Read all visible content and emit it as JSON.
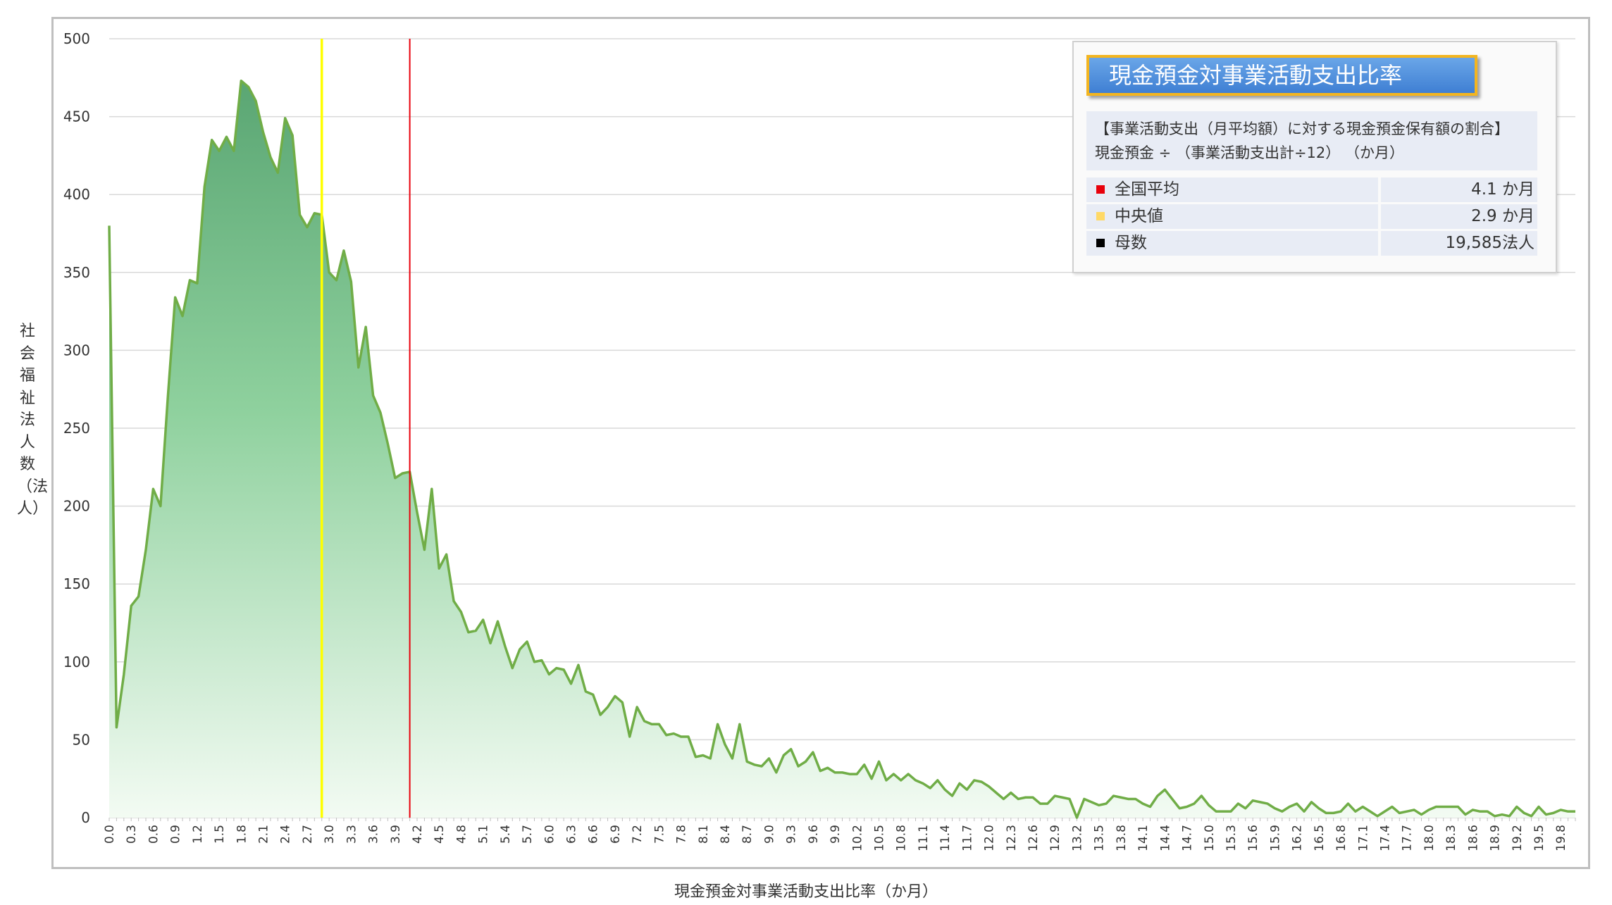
{
  "legend": {
    "title": "現金預金対事業活動支出比率",
    "desc_line1": "【事業活動支出（月平均額）に対する現金預金保有額の割合】",
    "desc_line2": "現金預金 ÷ （事業活動支出計÷12） （か月）",
    "rows": [
      {
        "label": "全国平均",
        "value": "4.1 か月",
        "color": "#e8000b"
      },
      {
        "label": "中央値",
        "value": "2.9 か月",
        "color": "#ffd966"
      },
      {
        "label": "母数",
        "value": "19,585法人",
        "color": "#000000"
      }
    ]
  },
  "colors": {
    "line": "#70ad47",
    "fill_top": "#5aa673",
    "fill_mid": "#8fd19e",
    "fill_bottom": "#f3fbf3",
    "mean_line": "#e8000b",
    "median_line": "#ffff00",
    "grid": "#d9d9d9"
  },
  "chart_data": {
    "type": "area",
    "title": "",
    "xlabel": "現金預金対事業活動支出比率（か月）",
    "ylabel": "社会福祉法人数（法人）",
    "ylim": [
      0,
      500
    ],
    "yticks": [
      0,
      50,
      100,
      150,
      200,
      250,
      300,
      350,
      400,
      450,
      500
    ],
    "x_start": 0.0,
    "x_step": 0.1,
    "x_tick_labels": [
      "0.0",
      "0.3",
      "0.6",
      "0.9",
      "1.2",
      "1.5",
      "1.8",
      "2.1",
      "2.4",
      "2.7",
      "3.0",
      "3.3",
      "3.6",
      "3.9",
      "4.2",
      "4.5",
      "4.8",
      "5.1",
      "5.4",
      "5.7",
      "6.0",
      "6.3",
      "6.6",
      "6.9",
      "7.2",
      "7.5",
      "7.8",
      "8.1",
      "8.4",
      "8.7",
      "9.0",
      "9.3",
      "9.6",
      "9.9",
      "10.2",
      "10.5",
      "10.8",
      "11.1",
      "11.4",
      "11.7",
      "12.0",
      "12.3",
      "12.6",
      "12.9",
      "13.2",
      "13.5",
      "13.8",
      "14.1",
      "14.4",
      "14.7",
      "15.0",
      "15.3",
      "15.6",
      "15.9",
      "16.2",
      "16.5",
      "16.8",
      "17.1",
      "17.4",
      "17.7",
      "18.0",
      "18.3",
      "18.6",
      "18.9",
      "19.2",
      "19.5",
      "19.8"
    ],
    "mean_x": 4.1,
    "median_x": 2.9,
    "grid": true,
    "series": [
      {
        "values": [
          380,
          58,
          92,
          136,
          142,
          172,
          211,
          200,
          270,
          334,
          322,
          345,
          343,
          405,
          435,
          428,
          437,
          428,
          473,
          469,
          460,
          440,
          424,
          414,
          449,
          438,
          387,
          379,
          388,
          387,
          350,
          345,
          364,
          344,
          289,
          315,
          271,
          260,
          240,
          218,
          221,
          222,
          196,
          172,
          211,
          160,
          169,
          139,
          132,
          119,
          120,
          127,
          112,
          126,
          110,
          96,
          108,
          113,
          100,
          101,
          92,
          96,
          95,
          86,
          98,
          81,
          79,
          66,
          71,
          78,
          74,
          52,
          71,
          62,
          60,
          60,
          53,
          54,
          52,
          52,
          39,
          40,
          38,
          60,
          47,
          38,
          60,
          36,
          34,
          33,
          38,
          29,
          40,
          44,
          33,
          36,
          42,
          30,
          32,
          29,
          29,
          28,
          28,
          34,
          25,
          36,
          24,
          28,
          24,
          28,
          24,
          22,
          19,
          24,
          18,
          14,
          22,
          18,
          24,
          23,
          20,
          16,
          12,
          16,
          12,
          13,
          13,
          9,
          9,
          14,
          13,
          12,
          0,
          12,
          10,
          8,
          9,
          14,
          13,
          12,
          12,
          9,
          7,
          14,
          18,
          12,
          6,
          7,
          9,
          14,
          8,
          4,
          4,
          4,
          9,
          6,
          11,
          10,
          9,
          6,
          4,
          7,
          9,
          4,
          10,
          6,
          3,
          3,
          4,
          9,
          4,
          7,
          4,
          1,
          4,
          7,
          3,
          4,
          5,
          2,
          5,
          7,
          7,
          7,
          7,
          2,
          5,
          4,
          4,
          1,
          2,
          1,
          7,
          3,
          1,
          7,
          2,
          3,
          5,
          4,
          4
        ]
      }
    ]
  }
}
